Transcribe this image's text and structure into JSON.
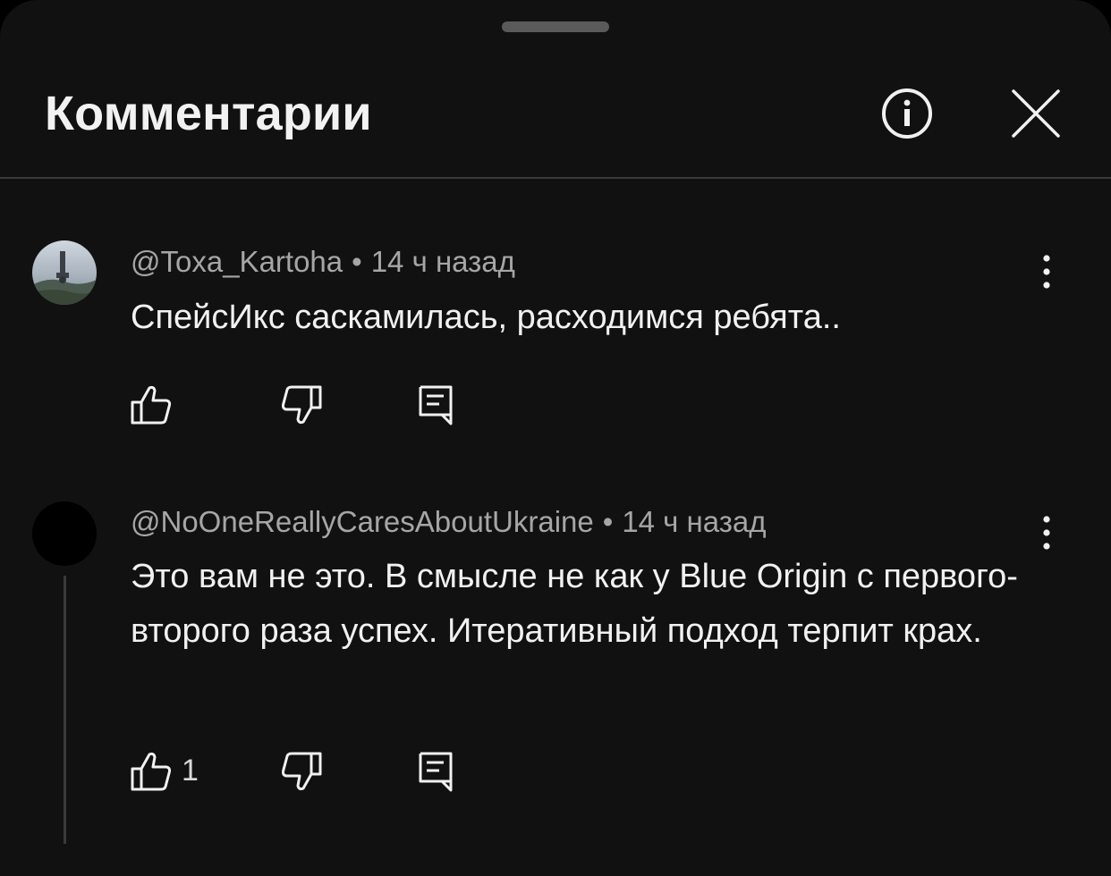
{
  "header": {
    "title": "Комментарии",
    "info_icon": "info-circle-icon",
    "close_icon": "close-icon"
  },
  "comments": [
    {
      "author": "@Toxa_Kartoha",
      "separator": "•",
      "time": "14 ч назад",
      "text": "СпейсИкс саскамилась, расходимся ребята..",
      "like_count": "",
      "avatar": "photo-avatar"
    },
    {
      "author": "@NoOneReallyCaresAboutUkraine",
      "separator": "•",
      "time": "14 ч назад",
      "text": "Это вам не это. В смысле не как у Blue Origin с первого-второго раза успех. Итеративный подход терпит крах.",
      "like_count": "1",
      "avatar": "black-avatar"
    }
  ],
  "colors": {
    "background": "#111111",
    "text_primary": "#f1f1f1",
    "text_secondary": "#a6a6a6",
    "divider": "#3a3a3a"
  }
}
